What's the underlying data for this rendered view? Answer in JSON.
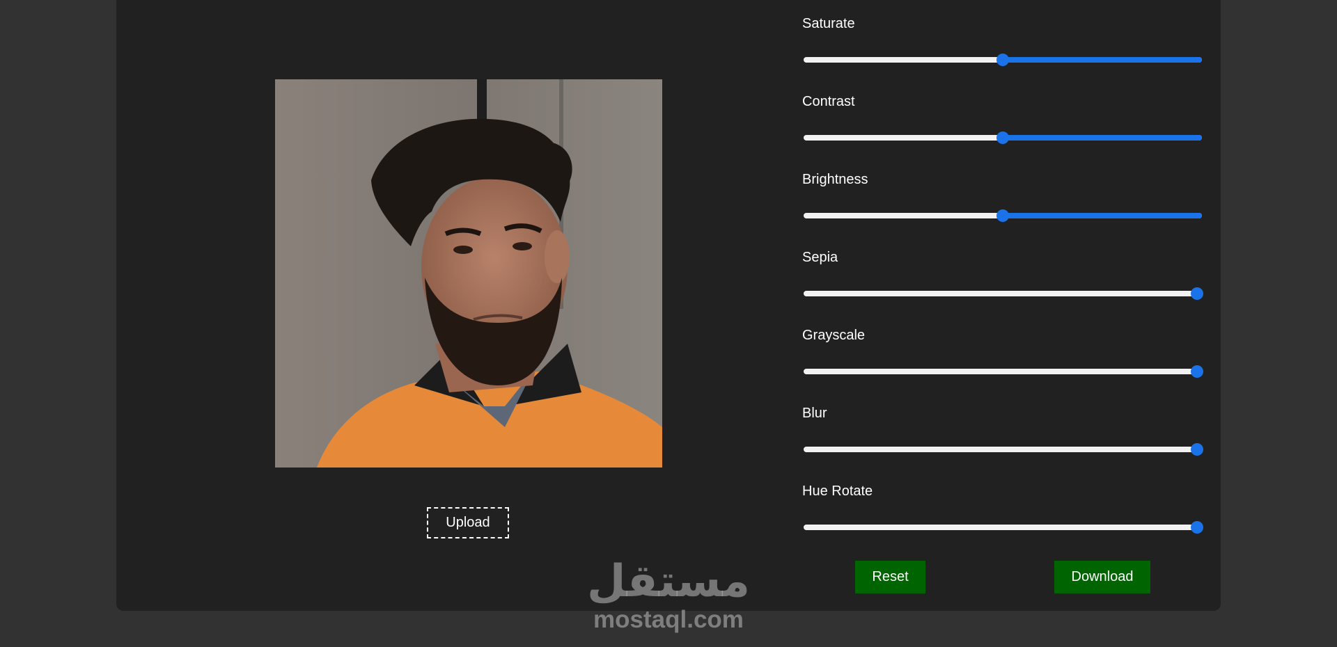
{
  "editor": {
    "upload_label": "Upload",
    "reset_label": "Reset",
    "download_label": "Download",
    "accent_color": "#1a73e8",
    "button_color": "#006400"
  },
  "sliders": [
    {
      "label": "Saturate",
      "value": 0.5
    },
    {
      "label": "Contrast",
      "value": 0.5
    },
    {
      "label": "Brightness",
      "value": 0.5
    },
    {
      "label": "Sepia",
      "value": 1.0
    },
    {
      "label": "Grayscale",
      "value": 1.0
    },
    {
      "label": "Blur",
      "value": 1.0
    },
    {
      "label": "Hue Rotate",
      "value": 1.0
    }
  ],
  "watermark": {
    "arabic": "مستقل",
    "latin": "mostaql.com"
  }
}
